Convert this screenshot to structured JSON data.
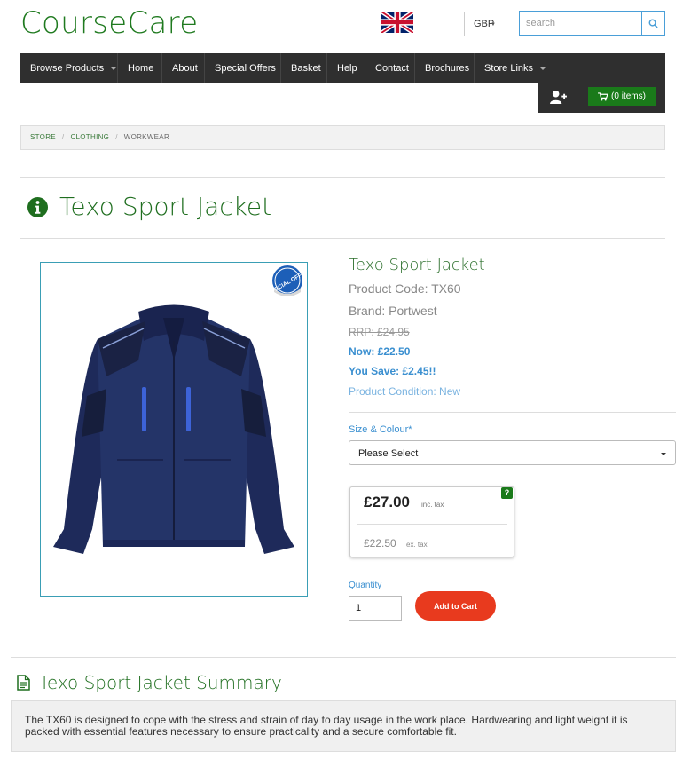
{
  "header": {
    "logo": "CourseCare",
    "currency": "GBP",
    "search_placeholder": "search"
  },
  "nav": {
    "items": [
      {
        "label": "Browse Products",
        "dropdown": true
      },
      {
        "label": "Home",
        "dropdown": false
      },
      {
        "label": "About",
        "dropdown": false
      },
      {
        "label": "Special Offers",
        "dropdown": false
      },
      {
        "label": "Basket",
        "dropdown": false
      },
      {
        "label": "Help",
        "dropdown": false
      },
      {
        "label": "Contact",
        "dropdown": false
      },
      {
        "label": "Brochures",
        "dropdown": false
      },
      {
        "label": "Store Links",
        "dropdown": true
      }
    ],
    "cart_label": "(0 items)"
  },
  "breadcrumb": {
    "store": "STORE",
    "clothing": "CLOTHING",
    "current": "WORKWEAR"
  },
  "page": {
    "title": "Texo Sport Jacket"
  },
  "product": {
    "image_badge": "SPECIAL OFFER",
    "name": "Texo Sport Jacket",
    "code": "Product Code: TX60",
    "brand": "Brand: Portwest",
    "rrp": "RRP: £24.95",
    "now": "Now: £22.50",
    "save": "You Save: £2.45!!",
    "condition": "Product Condition: New",
    "size_label": "Size & Colour*",
    "size_selected": "Please Select",
    "price_inc": "£27.00",
    "price_inc_label": "inc. tax",
    "price_ex": "£22.50",
    "price_ex_label": "ex. tax",
    "help_symbol": "?",
    "qty_label": "Quantity",
    "qty_value": "1",
    "add_to_cart": "Add to Cart"
  },
  "summary": {
    "title": "Texo Sport Jacket Summary",
    "text": "The TX60 is designed to cope with the stress and strain of day to day usage in the work place. Hardwearing and light weight it is packed with essential features necessary to ensure practicality and a secure comfortable fit."
  },
  "colors": {
    "brand_green": "#1f7a1f",
    "nav_dark": "#2f2f2f",
    "accent_blue": "#3a8fd0",
    "cta_red": "#e83a1e",
    "jacket_navy": "#1e2a5a"
  }
}
